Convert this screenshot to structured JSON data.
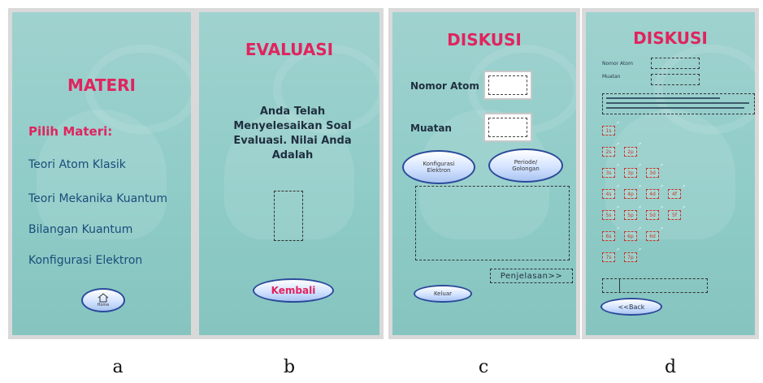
{
  "panel_a": {
    "title": "MATERI",
    "subtitle": "Pilih Materi:",
    "items": [
      "Teori Atom Klasik",
      "Teori Mekanika Kuantum",
      "Bilangan Kuantum",
      "Konfigurasi Elektron"
    ],
    "home_label": "Home",
    "home_icon": "home-icon"
  },
  "panel_b": {
    "title": "EVALUASI",
    "message": "Anda Telah Menyelesaikan Soal Evaluasi. Nilai Anda Adalah",
    "button": "Kembali"
  },
  "panel_c": {
    "title": "DISKUSI",
    "nomor_atom_label": "Nomor Atom",
    "muatan_label": "Muatan",
    "konfigurasi_button": "Konfigurasi Elektron",
    "periode_button": "Periode/ Golongan",
    "penjelasan_button": "Penjelasan>>",
    "keluar_button": "Keluar"
  },
  "panel_d": {
    "title": "DISKUSI",
    "nomor_atom_label": "Nomor Atom",
    "muatan_label": "Muatan",
    "orbitals": [
      [
        "1s"
      ],
      [
        "2s",
        "2p"
      ],
      [
        "3s",
        "3p",
        "3d"
      ],
      [
        "4s",
        "4p",
        "4d",
        "4f"
      ],
      [
        "5s",
        "5p",
        "5d",
        "5f"
      ],
      [
        "6s",
        "6p",
        "6d"
      ],
      [
        "7s",
        "7p"
      ]
    ],
    "back_button": "<<Back"
  },
  "captions": [
    "a",
    "b",
    "c",
    "d"
  ],
  "colors": {
    "title": "#e0245e",
    "text": "#1a4d7a",
    "panel_bg": "#9fd2cf",
    "button_border": "#2a4a9a"
  }
}
